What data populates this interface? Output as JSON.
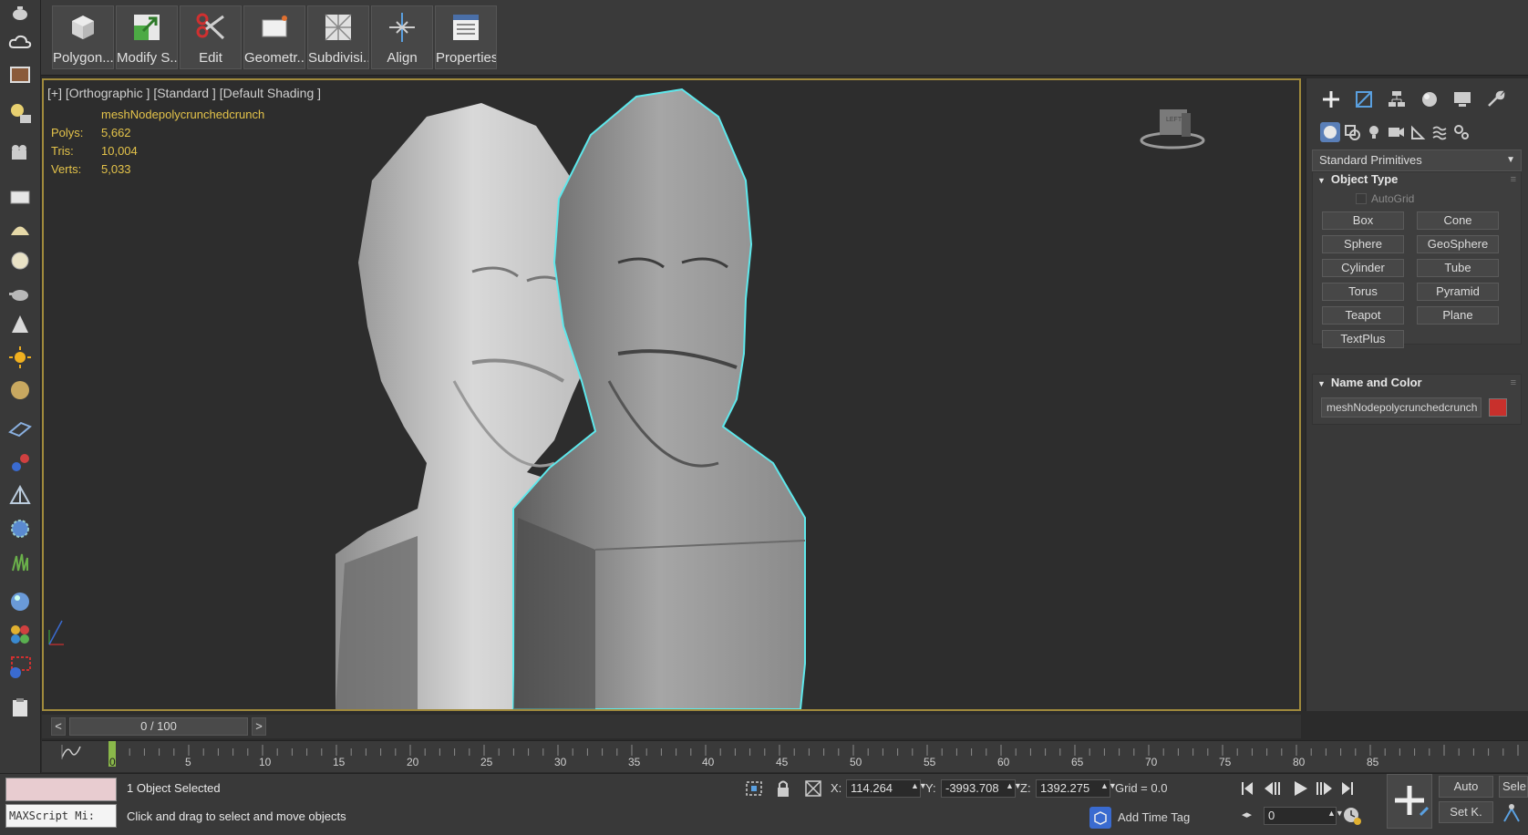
{
  "ribbon": {
    "buttons": [
      {
        "label": "Polygon...",
        "icon": "cube-icon"
      },
      {
        "label": "Modify S...",
        "icon": "modify-selection-icon"
      },
      {
        "label": "Edit",
        "icon": "scissors-icon"
      },
      {
        "label": "Geometr...",
        "icon": "geometry-icon"
      },
      {
        "label": "Subdivisi...",
        "icon": "subdivision-icon"
      },
      {
        "label": "Align",
        "icon": "align-icon"
      },
      {
        "label": "Properties",
        "icon": "properties-icon"
      }
    ]
  },
  "viewport": {
    "label": "[+] [Orthographic ] [Standard ] [Default Shading ]",
    "object_name": "meshNodepolycrunchedcrunch",
    "stats": [
      {
        "key": "Polys:",
        "value": "5,662"
      },
      {
        "key": "Tris:",
        "value": "10,004"
      },
      {
        "key": "Verts:",
        "value": "5,033"
      }
    ],
    "viewcube_label": "LEFT"
  },
  "command_panel": {
    "dropdown_value": "Standard Primitives",
    "object_type_title": "Object Type",
    "autogrid_label": "AutoGrid",
    "primitives": [
      "Box",
      "Cone",
      "Sphere",
      "GeoSphere",
      "Cylinder",
      "Tube",
      "Torus",
      "Pyramid",
      "Teapot",
      "Plane",
      "TextPlus"
    ],
    "name_color_title": "Name and Color",
    "object_name_value": "meshNodepolycrunchedcrunch",
    "object_color": "#c8302c"
  },
  "timeline": {
    "frame_display": "0 / 100",
    "prev": "<",
    "next": ">",
    "ticks": [
      "5",
      "10",
      "15",
      "20",
      "25",
      "30",
      "35",
      "40",
      "45",
      "50",
      "55",
      "60",
      "65",
      "70",
      "75",
      "80",
      "85"
    ],
    "current_frame": "0"
  },
  "status": {
    "maxscript_placeholder": "MAXScript Mi:",
    "selection_text": "1 Object Selected",
    "prompt_text": "Click and drag to select and move objects",
    "x_label": "X:",
    "x_value": "114.264",
    "y_label": "Y:",
    "y_value": "-3993.708",
    "z_label": "Z:",
    "z_value": "1392.275",
    "grid_text": "Grid = 0.0",
    "add_time_tag": "Add Time Tag",
    "frame_field": "0",
    "auto_label": "Auto",
    "setkey_label": "Set K.",
    "sele_label": "Sele"
  },
  "colors": {
    "accent": "#a08a3c",
    "selection_outline": "#5ee8ec",
    "stat_yellow": "#e4c34a"
  }
}
